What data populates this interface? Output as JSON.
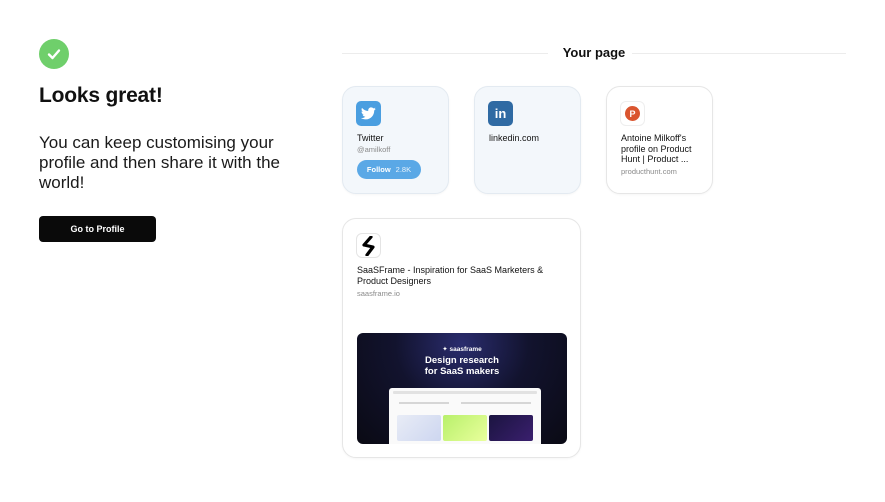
{
  "left": {
    "headline": "Looks great!",
    "subtext": "You can keep customising your profile and then share it with the world!",
    "button_label": "Go to Profile"
  },
  "right": {
    "section_title": "Your page"
  },
  "cards": {
    "twitter": {
      "title": "Twitter",
      "handle": "@amilkoff",
      "follow_label": "Follow",
      "follow_count": "2.8K",
      "icon": "twitter-icon",
      "color": "#4a9ee0"
    },
    "linkedin": {
      "title": "linkedin.com",
      "icon": "linkedin-icon",
      "color": "#2f6aa3"
    },
    "producthunt": {
      "title": "Antoine Milkoff's profile on Product Hunt | Product ...",
      "domain": "producthunt.com",
      "icon": "product-hunt-icon",
      "color": "#da552f"
    },
    "saasframe": {
      "title": "SaaSFrame - Inspiration for SaaS Marketers & Product Designers",
      "domain": "saasframe.io",
      "icon": "saasframe-logo-icon",
      "preview_brand": "saasframe",
      "preview_headline_1": "Design research",
      "preview_headline_2": "for SaaS makers"
    }
  },
  "colors": {
    "success": "#6fcf6b",
    "primary_button": "#0a0a0a",
    "follow_button": "#5aa8e6"
  }
}
